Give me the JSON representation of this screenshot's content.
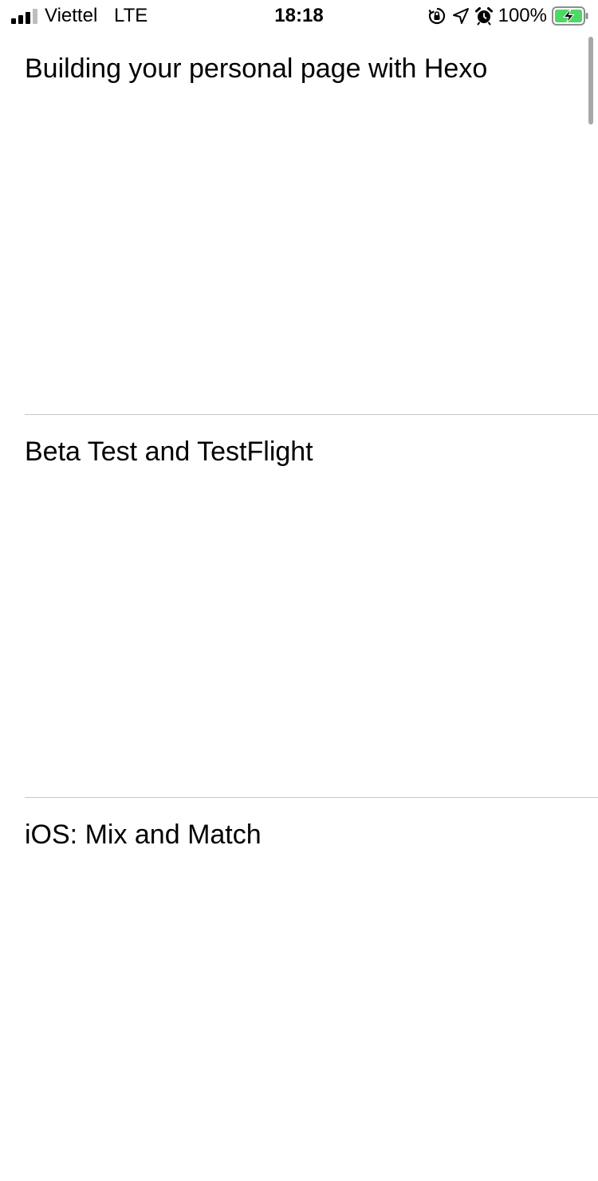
{
  "status_bar": {
    "carrier": "Viettel",
    "network": "LTE",
    "time": "18:18",
    "battery_percent": "100%",
    "battery_color": "#4cd964",
    "icons": [
      "signal-icon",
      "rotation-lock-icon",
      "location-arrow-icon",
      "alarm-clock-icon",
      "battery-charging-icon"
    ]
  },
  "posts": [
    {
      "title": "Building your personal page with Hexo"
    },
    {
      "title": "Beta Test and TestFlight"
    },
    {
      "title": "iOS: Mix and Match"
    }
  ],
  "separator_color": "#c8c7cc"
}
